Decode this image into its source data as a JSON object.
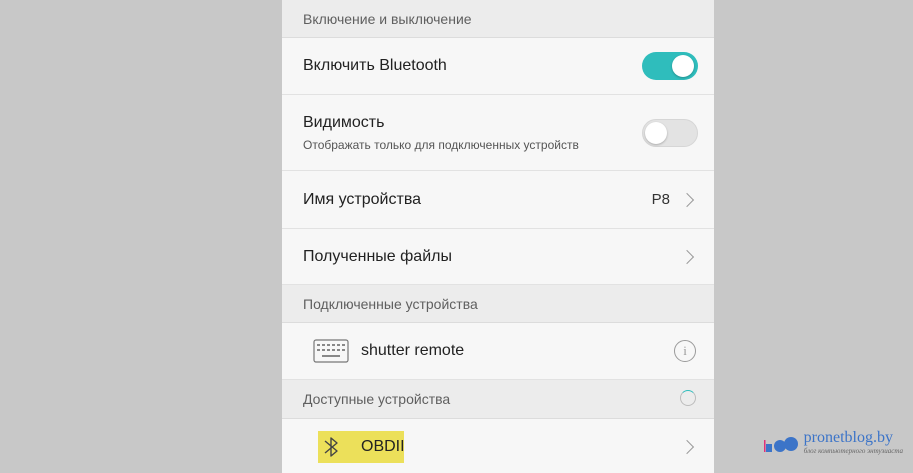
{
  "sections": {
    "power": "Включение и выключение",
    "paired": "Подключенные устройства",
    "available": "Доступные устройства"
  },
  "settings": {
    "bluetooth_label": "Включить Bluetooth",
    "bluetooth_on": true,
    "visibility_label": "Видимость",
    "visibility_sub": "Отображать только для подключенных устройств",
    "visibility_on": false,
    "device_name_label": "Имя устройства",
    "device_name_value": "P8",
    "received_files_label": "Полученные файлы"
  },
  "paired_devices": [
    {
      "name": "shutter remote",
      "icon": "keyboard-icon"
    }
  ],
  "available_devices": [
    {
      "name": "OBDII",
      "icon": "bluetooth-icon"
    }
  ],
  "watermark": {
    "title": "pronetblog.by",
    "subtitle": "блог компьютерного энтузиаста"
  },
  "colors": {
    "accent": "#2fbdbc",
    "highlight": "#ece05a"
  }
}
